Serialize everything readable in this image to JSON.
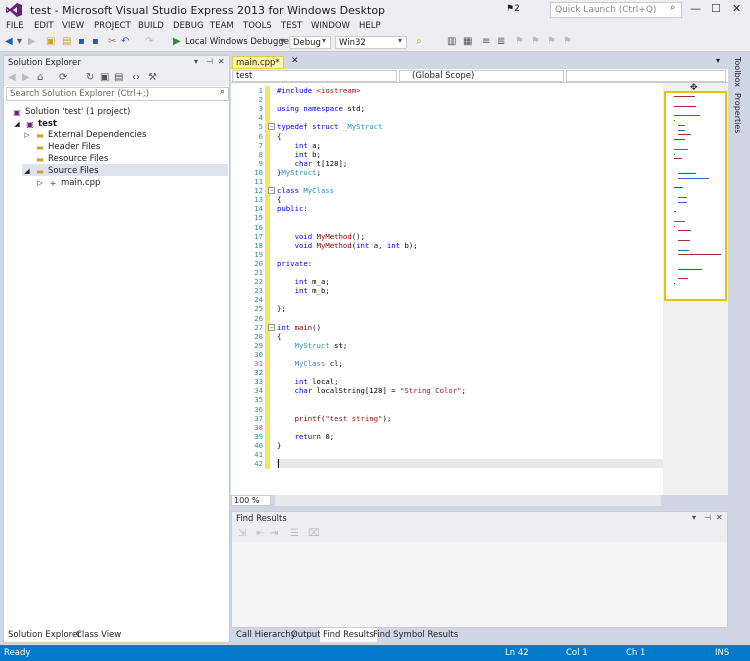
{
  "window": {
    "title": "test - Microsoft Visual Studio Express 2013 for Windows Desktop",
    "notifications": "2",
    "quick_launch_placeholder": "Quick Launch (Ctrl+Q)"
  },
  "menu": [
    "FILE",
    "EDIT",
    "VIEW",
    "PROJECT",
    "BUILD",
    "DEBUG",
    "TEAM",
    "TOOLS",
    "TEST",
    "WINDOW",
    "HELP"
  ],
  "toolbar": {
    "debug_target": "Local Windows Debugger",
    "configuration": "Debug",
    "platform": "Win32"
  },
  "solution_explorer": {
    "title": "Solution Explorer",
    "search_placeholder": "Search Solution Explorer (Ctrl+;)",
    "tree": [
      {
        "label": "Solution 'test' (1 project)"
      },
      {
        "label": "test"
      },
      {
        "label": "External Dependencies"
      },
      {
        "label": "Header Files"
      },
      {
        "label": "Resource Files"
      },
      {
        "label": "Source Files"
      },
      {
        "label": "main.cpp"
      }
    ],
    "tabs": [
      "Solution Explorer",
      "Class View"
    ]
  },
  "editor": {
    "tab": "main.cpp*",
    "nav_project": "test",
    "nav_scope": "(Global Scope)",
    "zoom": "100 %",
    "lines": [
      "#include <iostream>",
      "",
      "using namespace std;",
      "",
      "typedef struct _MyStruct",
      "{",
      "    int a;",
      "    int b;",
      "    char t[128];",
      "}MyStruct;",
      "",
      "class MyClass",
      "{",
      "public:",
      "",
      "",
      "    void MyMethod();",
      "    void MyMethod(int a, int b);",
      "",
      "private:",
      "",
      "    int m_a;",
      "    int m_b;",
      "",
      "};",
      "",
      "int main()",
      "{",
      "    MyStruct st;",
      "",
      "    MyClass cl;",
      "",
      "    int local;",
      "    char localString[128] = \"String Color\";",
      "",
      "",
      "    printf(\"test string\");",
      "",
      "    return 0;",
      "}",
      "",
      ""
    ]
  },
  "find_results": {
    "title": "Find Results"
  },
  "bottom_tabs": [
    "Call Hierarchy",
    "Output",
    "Find Results",
    "Find Symbol Results"
  ],
  "right_tabs": [
    "Toolbox",
    "Properties"
  ],
  "status": {
    "state": "Ready",
    "line": "Ln 42",
    "col": "Col 1",
    "ch": "Ch 1",
    "mode": "INS"
  },
  "colors": {
    "accent": "#007acc",
    "keyword": "#0000ff",
    "type": "#2b91af",
    "string": "#a31515",
    "changed": "#f3e46a"
  }
}
